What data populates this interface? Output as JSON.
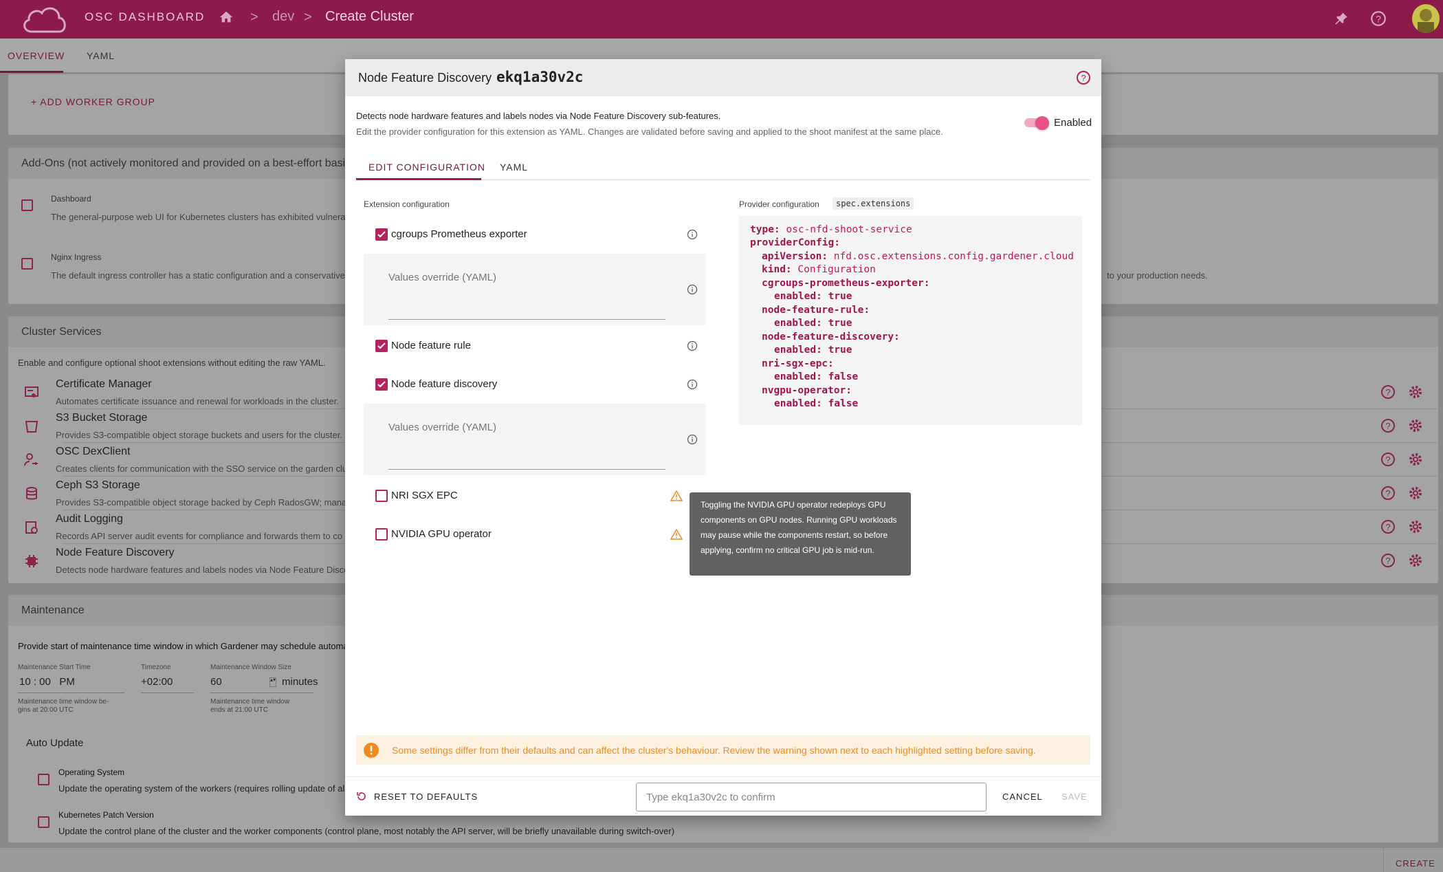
{
  "header": {
    "app_title": "OSC DASHBOARD",
    "breadcrumb_separator": ">",
    "breadcrumb": [
      "dev",
      "Create Cluster"
    ],
    "icons": [
      "cloud-logo",
      "home-icon",
      "pin-icon",
      "help-icon",
      "avatar"
    ]
  },
  "page_tabs": [
    "OVERVIEW",
    "YAML"
  ],
  "workers": {
    "add_worker_group": "ADD WORKER GROUP"
  },
  "addons": {
    "title": "Add-Ons (not actively monitored and provided on a best-effort basis only)",
    "items": [
      {
        "name": "Dashboard",
        "desc": "The general-purpose web UI for Kubernetes clusters has exhibited vulnerab"
      },
      {
        "name": "Nginx Ingress",
        "desc": "The default ingress controller has a static configuration and a conservative",
        "desc_tail": "to your production needs."
      }
    ]
  },
  "cluster_services": {
    "title": "Cluster Services",
    "intro": "Enable and configure optional shoot extensions without editing the raw YAML.",
    "items": [
      {
        "name": "Certificate Manager",
        "desc": "Automates certificate issuance and renewal for workloads in the cluster.",
        "icon": "certificate-icon"
      },
      {
        "name": "S3 Bucket Storage",
        "desc": "Provides S3-compatible object storage buckets and users for the cluster.",
        "icon": "bucket-icon"
      },
      {
        "name": "OSC DexClient",
        "desc": "Creates clients for communication with the SSO service on the garden clu",
        "icon": "user-key-icon"
      },
      {
        "name": "Ceph S3 Storage",
        "desc": "Provides S3-compatible object storage backed by Ceph RadosGW; manag",
        "icon": "database-icon"
      },
      {
        "name": "Audit Logging",
        "desc": "Records API server audit events for compliance and forwards them to co",
        "icon": "audit-icon"
      },
      {
        "name": "Node Feature Discovery",
        "desc": "Detects node hardware features and labels nodes via Node Feature Discove",
        "icon": "chip-icon"
      }
    ]
  },
  "maintenance": {
    "title": "Maintenance",
    "intro": "Provide start of maintenance time window in which Gardener may schedule automat",
    "start_label": "Maintenance Start Time",
    "start_value": "10 : 00   PM",
    "start_hint_1": "Maintenance time window be-",
    "start_hint_2": "gins at 20:00 UTC",
    "tz_label": "Timezone",
    "tz_value": "+02:00",
    "size_label": "Maintenance Window Size",
    "size_value": "60",
    "size_unit": "minutes",
    "size_hint_1": "Maintenance time window",
    "size_hint_2": "ends at 21:00 UTC",
    "auto_update": "Auto Update",
    "os_title": "Operating System",
    "os_desc": "Update the operating system of the workers (requires rolling update of al",
    "k8s_title": "Kubernetes Patch Version",
    "k8s_desc": "Update the control plane of the cluster and the worker components (control plane, most notably the API server, will be briefly unavailable during switch-over)"
  },
  "bottom": {
    "create": "CREATE"
  },
  "dialog": {
    "title": "Node Feature Discovery",
    "cluster_id": "ekq1a30v2c",
    "desc": "Detects node hardware features and labels nodes via Node Feature Discovery sub-features.",
    "subdesc": "Edit the provider configuration for this extension as YAML. Changes are validated before saving and applied to the shoot manifest at the same place.",
    "enabled_label": "Enabled",
    "tabs": [
      "EDIT CONFIGURATION",
      "YAML"
    ],
    "ext_config_label": "Extension configuration",
    "features": [
      {
        "label": "cgroups Prometheus exporter",
        "checked": true
      },
      {
        "label": "Node feature rule",
        "checked": true
      },
      {
        "label": "Node feature discovery",
        "checked": true
      },
      {
        "label": "NRI SGX EPC",
        "checked": false
      },
      {
        "label": "NVIDIA GPU operator",
        "checked": false
      }
    ],
    "override_placeholder": "Values override (YAML)",
    "provider_label": "Provider configuration",
    "provider_path": "spec.extensions",
    "yaml": {
      "type_k": "type:",
      "type_v": "osc-nfd-shoot-service",
      "pc_k": "providerConfig:",
      "api_k": "apiVersion:",
      "api_v": "nfd.osc.extensions.config.gardener.cloud",
      "kind_k": "kind:",
      "kind_v": "Configuration",
      "f1_k": "cgroups-prometheus-exporter:",
      "f2_k": "node-feature-rule:",
      "f3_k": "node-feature-discovery:",
      "f4_k": "nri-sgx-epc:",
      "f5_k": "nvgpu-operator:",
      "en_k": "enabled:",
      "true_v": "true",
      "false_v": "false"
    },
    "tooltip": "Toggling the NVIDIA GPU operator redeploys GPU components on GPU nodes. Running GPU workloads may pause while the components restart, so before applying, confirm no critical GPU job is mid-run.",
    "warning": "Some settings differ from their defaults and can affect the cluster's behaviour. Review the warning shown next to each highlighted setting before saving.",
    "reset": "RESET TO DEFAULTS",
    "confirm_placeholder": "Type ekq1a30v2c to confirm",
    "cancel": "CANCEL",
    "save": "SAVE",
    "colors": {
      "primary": "#8c1a4b",
      "accent": "#b3245e",
      "warning": "#ef8b1e",
      "toggle": "#e8508a"
    }
  }
}
